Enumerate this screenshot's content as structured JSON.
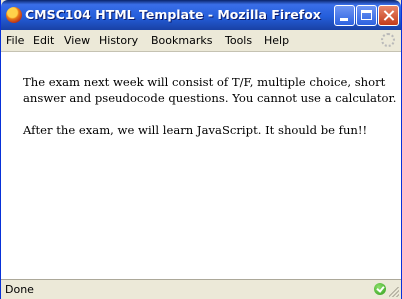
{
  "window": {
    "title": "CMSC104 HTML Template - Mozilla Firefox"
  },
  "menu": {
    "items": [
      "File",
      "Edit",
      "View",
      "History",
      "Bookmarks",
      "Tools",
      "Help"
    ]
  },
  "content": {
    "paragraphs": [
      "The exam next week will consist of T/F, multiple choice, short answer and pseudocode questions. You cannot use a calculator.",
      "After the exam, we will learn JavaScript. It should be fun!!"
    ]
  },
  "status": {
    "text": "Done"
  },
  "icons": {
    "app": "firefox-icon",
    "throbber": "throbber-icon",
    "status": "green-check-icon",
    "grip": "resize-grip-icon"
  }
}
